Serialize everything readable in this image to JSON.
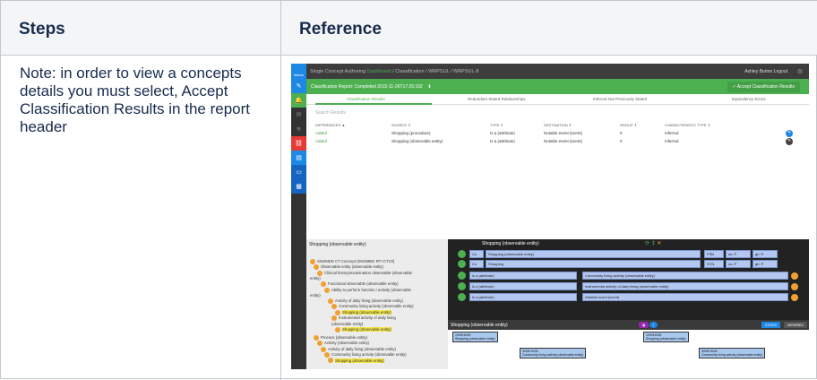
{
  "table": {
    "header_steps": "Steps",
    "header_reference": "Reference",
    "note": "Note: in order to view a concepts details you must select, Accept Classification Results in the report header"
  },
  "app": {
    "logo": "ihtsdo",
    "title": "Single Concept Authoring",
    "crumb_home": "Dashboard",
    "crumb_rest": "/ Classification / WRPSUL / WRPSUL-8",
    "user": "Ashley Burton  Logout"
  },
  "report": {
    "title": "Classification Report: Completed 2015-11-26T17:26:18Z",
    "accept_label": "✓ Accept Classification Results"
  },
  "tabs": [
    "Classification Results",
    "Redundant Stated Relationships",
    "Inferred Not Previously Stated",
    "Equivalency Errors"
  ],
  "results": {
    "search_placeholder": "Search Results",
    "columns": [
      "DIFFERENCES ▲",
      "SOURCE ⇕",
      "TYPE ⇕",
      "DESTINATION ⇕",
      "GROUP ⇕",
      "CHARACTERISTIC TYPE ⇕"
    ],
    "rows": [
      [
        "Added",
        "Shopping (procedure)",
        "Is a (attribute)",
        "Notable event (event)",
        "0",
        "Inferred"
      ],
      [
        "Added",
        "Shopping (observable entity)",
        "Is a (attribute)",
        "Notable event (event)",
        "0",
        "Inferred"
      ]
    ]
  },
  "hierarchy": {
    "title": "Shopping (observable entity)",
    "lines": [
      "SNOMED CT Concept (SNOMED RT+CTV3)",
      "Observable entity (observable entity)",
      "Clinical history/examination observable (observable",
      "entity)",
      "Functional observable (observable entity)",
      "Ability to perform function / activity (observable",
      "entity)",
      "Activity of daily living (observable entity)",
      "Community living activity (observable entity)",
      "Shopping (observable entity)",
      "Instrumental activity of daily living",
      "(observable entity)",
      "Shopping (observable entity)",
      "Process (observable entity)",
      "Activity (observable entity)",
      "Activity of daily living (observable entity)",
      "Community living activity (observable entity)",
      "Shopping (observable entity)",
      "Instrumental activity of daily living",
      "(observable entity)",
      "Shopping (observable entity)"
    ]
  },
  "editor": {
    "title": "Shopping (observable entity)",
    "fsn": "Shopping (observable entity)",
    "syn": "Shopping",
    "fsn_tag": "FSN",
    "syn_tag": "SYN",
    "acc1": "us: P",
    "acc2": "gb: P",
    "cs": "Cs",
    "isa": "Is a (attribute)",
    "rel1": "Community living activity (observable entity)",
    "rel2": "Instrumental activity of daily living (observable entity)",
    "rel3": "Notable event (event)"
  },
  "diagram": {
    "title": "Shopping (observable entity)",
    "stated": "STATED",
    "inferred": "INFERRED",
    "root_id": "109011005",
    "root_label": "Shopping (observable entity)",
    "c1_id": "300874005",
    "c1_label": "Community living activity (observable entity)",
    "c2_id": "414514006",
    "c2_label": "Instrumental activity of daily living (observable entity)",
    "c3_id": "405613005",
    "c3_label": "Notable event (event)"
  },
  "colors": {
    "accent_green": "#4caf50",
    "concept_blue": "#a9c8ee"
  }
}
